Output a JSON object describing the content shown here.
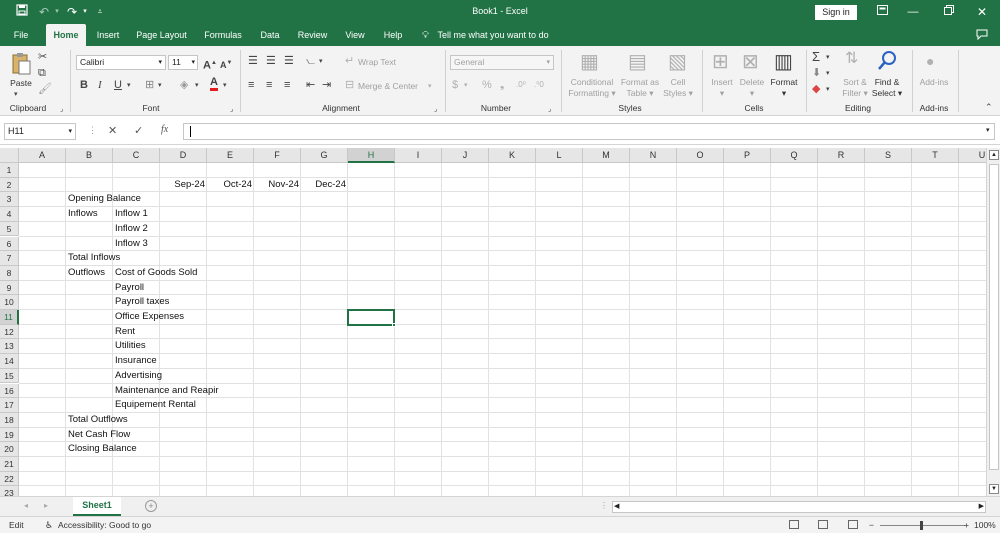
{
  "titlebar": {
    "title": "Book1 - Excel",
    "signin": "Sign in",
    "accent": "#217346"
  },
  "tabs": [
    "File",
    "Home",
    "Insert",
    "Page Layout",
    "Formulas",
    "Data",
    "Review",
    "View",
    "Help"
  ],
  "tellme": "Tell me what you want to do",
  "ribbon": {
    "clipboard": {
      "paste": "Paste",
      "label": "Clipboard"
    },
    "font": {
      "name": "Calibri",
      "size": "11",
      "label": "Font"
    },
    "alignment": {
      "wrap": "Wrap Text",
      "merge": "Merge & Center",
      "label": "Alignment"
    },
    "number": {
      "format": "General",
      "label": "Number"
    },
    "styles": {
      "cond1": "Conditional",
      "cond2": "Formatting",
      "fmt1": "Format as",
      "fmt2": "Table",
      "cell1": "Cell",
      "cell2": "Styles",
      "label": "Styles"
    },
    "cells": {
      "insert": "Insert",
      "delete": "Delete",
      "format": "Format",
      "label": "Cells"
    },
    "editing": {
      "sort1": "Sort &",
      "sort2": "Filter",
      "find1": "Find &",
      "find2": "Select",
      "label": "Editing"
    },
    "addins": {
      "btn": "Add-ins",
      "label": "Add-ins"
    }
  },
  "formula_bar": {
    "namebox": "H11",
    "fx": "fx",
    "value": ""
  },
  "columns": [
    "A",
    "B",
    "C",
    "D",
    "E",
    "F",
    "G",
    "H",
    "I",
    "J",
    "K",
    "L",
    "M",
    "N",
    "O",
    "P",
    "Q",
    "R",
    "S",
    "T",
    "U"
  ],
  "rows": [
    "1",
    "2",
    "3",
    "4",
    "5",
    "6",
    "7",
    "8",
    "9",
    "10",
    "11",
    "12",
    "13",
    "14",
    "15",
    "16",
    "17",
    "18",
    "19",
    "20",
    "21",
    "22",
    "23"
  ],
  "cells": {
    "D2": "Sep-24",
    "E2": "Oct-24",
    "F2": "Nov-24",
    "G2": "Dec-24",
    "B3": "Opening Balance",
    "B4": "Inflows",
    "C4": "Inflow 1",
    "C5": "Inflow 2",
    "C6": "Inflow 3",
    "B7": "Total Inflows",
    "B8": "Outflows",
    "C8": "Cost of Goods Sold",
    "C9": "Payroll",
    "C10": "Payroll taxes",
    "C11": "Office Expenses",
    "C12": "Rent",
    "C13": "Utilities",
    "C14": "Insurance",
    "C15": "Advertising",
    "C16": "Maintenance and Reapir",
    "C17": "Equipement Rental",
    "B18": "Total Outflows",
    "B19": "Net Cash Flow",
    "B20": "Closing Balance"
  },
  "selected_cell": "H11",
  "sheets": [
    "Sheet1"
  ],
  "status": {
    "mode": "Edit",
    "accessibility": "Accessibility: Good to go",
    "zoom": "100%"
  }
}
